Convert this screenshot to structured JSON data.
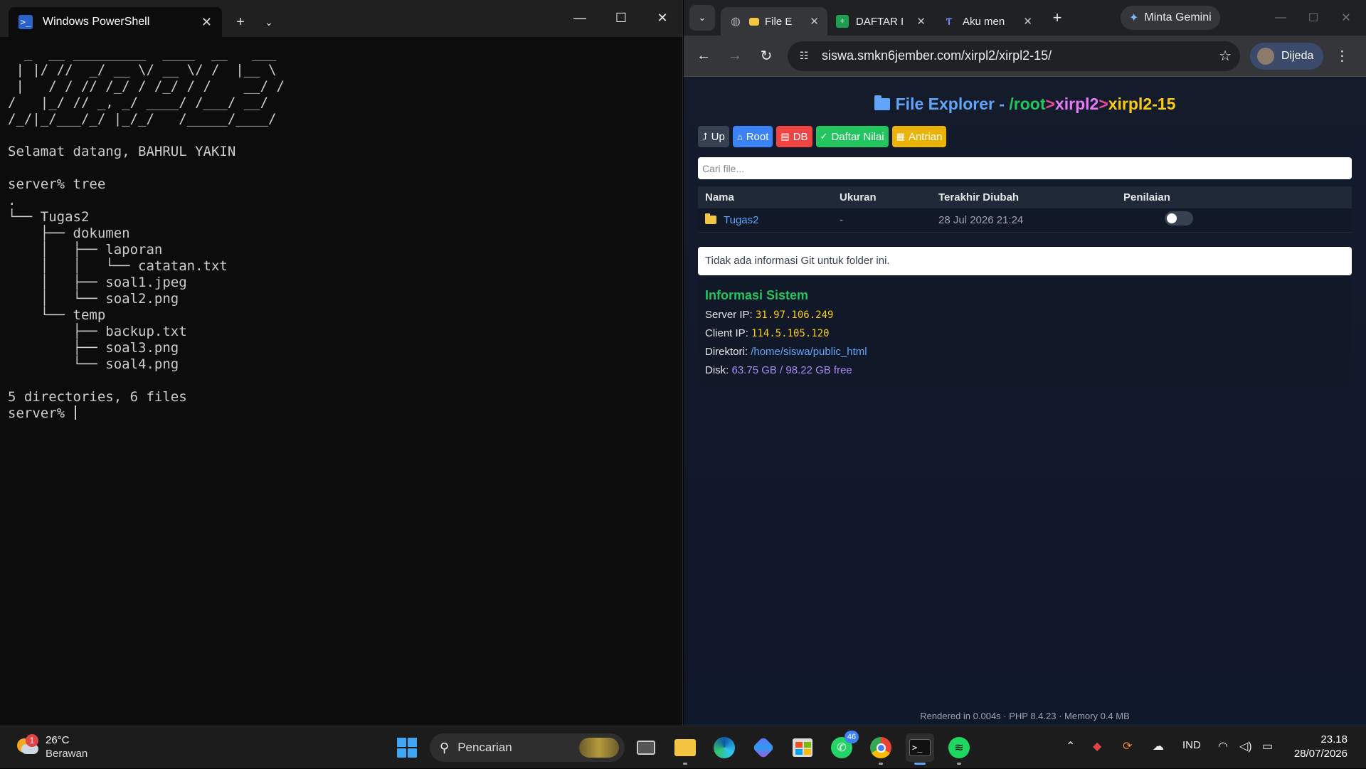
{
  "terminal": {
    "tab_title": "Windows PowerShell",
    "new_tab_glyph": "+",
    "ascii_art": "  _  __ _________  ____  __   ___\n | |/ //  _/ __ \\/ __ \\/ /  |__ \\\n |   / / // /_/ / /_/ / /    __/ /\n/   |_/ // _, _/ ____/ /___/ __/\n/_/|_/___/_/ |_/_/   /_____/____/",
    "lines": [
      "",
      "Selamat datang, BAHRUL YAKIN",
      "",
      "server% tree",
      ".",
      "└── Tugas2",
      "    ├── dokumen",
      "    │   ├── laporan",
      "    │   │   └── catatan.txt",
      "    │   ├── soal1.jpeg",
      "    │   └── soal2.png",
      "    └── temp",
      "        ├── backup.txt",
      "        ├── soal3.png",
      "        └── soal4.png",
      "",
      "5 directories, 6 files"
    ],
    "prompt": "server% "
  },
  "browser": {
    "tabs": [
      {
        "title": "File E",
        "favicon": "folder-icon",
        "active": true
      },
      {
        "title": "DAFTAR I",
        "favicon": "sheets-icon",
        "active": false
      },
      {
        "title": "Aku men",
        "favicon": "ai-icon",
        "active": false
      }
    ],
    "gemini_label": "Minta Gemini",
    "url": "siswa.smkn6jember.com/xirpl2/xirpl2-15/",
    "profile_label": "Dijeda"
  },
  "page": {
    "title_prefix": "File Explorer - ",
    "crumb_root": "/root",
    "crumb_sep": ">",
    "crumb_a": "xirpl2",
    "crumb_b": "xirpl2-15",
    "buttons": {
      "up": "Up",
      "root": "Root",
      "db": "DB",
      "nilai": "Daftar Nilai",
      "antrian": "Antrian"
    },
    "search_placeholder": "Cari file...",
    "table": {
      "headers": [
        "Nama",
        "Ukuran",
        "Terakhir Diubah",
        "Penilaian"
      ],
      "rows": [
        {
          "name": "Tugas2",
          "size": "-",
          "modified": "28 Jul 2026 21:24"
        }
      ]
    },
    "git_info": "Tidak ada informasi Git untuk folder ini.",
    "sysinfo": {
      "heading": "Informasi Sistem",
      "server_ip_label": "Server IP: ",
      "server_ip": "31.97.106.249",
      "client_ip_label": "Client IP: ",
      "client_ip": "114.5.105.120",
      "dir_label": "Direktori: ",
      "dir": "/home/siswa/public_html",
      "disk_label": "Disk: ",
      "disk": "63.75 GB / 98.22 GB free"
    },
    "footer": "Rendered in 0.004s · PHP 8.4.23 · Memory 0.4 MB"
  },
  "taskbar": {
    "weather_temp": "26°C",
    "weather_cond": "Berawan",
    "weather_badge": "1",
    "search_label": "Pencarian",
    "whatsapp_badge": "46",
    "language": "IND",
    "time": "23.18",
    "date": "28/07/2026"
  },
  "colors": {
    "accent_blue": "#60a5fa",
    "green": "#22c55e",
    "yellow": "#facc15",
    "pink": "#ec4899",
    "purple": "#a78bfa",
    "terminal_bg": "#0c0c0c",
    "page_bg": "#0f172a"
  }
}
